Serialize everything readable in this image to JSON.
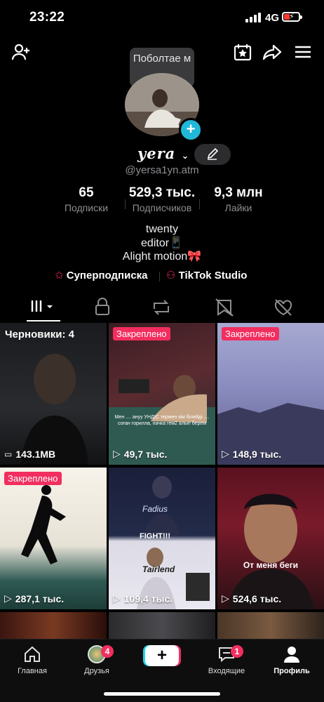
{
  "status_bar": {
    "time": "23:22",
    "network": "4G"
  },
  "header": {
    "tooltip": "Поболтае м"
  },
  "profile": {
    "username": "yera",
    "handle": "@yersa1yn.atm",
    "stats": [
      {
        "value": "65",
        "label": "Подписки"
      },
      {
        "value": "529,3 тыс.",
        "label": "Подписчиков"
      },
      {
        "value": "9,3 млн",
        "label": "Лайки"
      }
    ],
    "bio": [
      "twenty",
      "editor📱",
      "Alight motion🎀"
    ],
    "links": {
      "super": "Суперподписка",
      "studio": "TikTok Studio"
    }
  },
  "grid": {
    "draft_label": "Черновики: 4",
    "draft_size": "143.1MB",
    "pinned_label": "Закреплено",
    "tiles": [
      {
        "views": "49,7 тыс.",
        "caption": "Мен .... ануу УНДІС термен кім білейді .... соған горилла, пачка гем2 алып берем"
      },
      {
        "views": "148,9 тыс."
      },
      {
        "views": "287,1 тыс."
      },
      {
        "views": "109,4 тыс.",
        "overlay_top": "Fadius",
        "overlay_mid": "FIGHT!!!",
        "overlay_bottom": "Tairlend"
      },
      {
        "views": "524,6 тыс.",
        "caption": "От меня беги"
      }
    ]
  },
  "bottom_nav": {
    "home": "Главная",
    "friends": "Друзья",
    "friends_badge": "4",
    "inbox": "Входящие",
    "inbox_badge": "1",
    "profile": "Профиль"
  },
  "colors": {
    "accent": "#f22e5f",
    "cyan": "#20b8d8",
    "muted": "#8e8e93"
  }
}
